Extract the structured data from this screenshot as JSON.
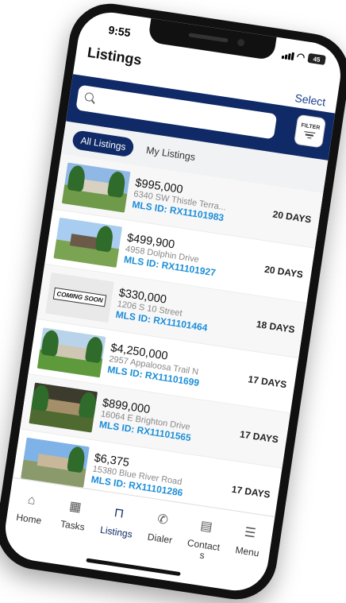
{
  "status": {
    "time": "9:55",
    "battery": "45"
  },
  "header": {
    "title": "Listings",
    "select_label": "Select"
  },
  "search": {
    "placeholder": "",
    "filter_label": "FILTER"
  },
  "tabs": [
    {
      "label": "All Listings",
      "active": true
    },
    {
      "label": "My Listings",
      "active": false
    }
  ],
  "listings": [
    {
      "price": "$995,000",
      "address": "6340 SW Thistle Terra...",
      "mls": "MLS ID: RX11101983",
      "days": "20 DAYS"
    },
    {
      "price": "$499,900",
      "address": "4958 Dolphin Drive",
      "mls": "MLS ID: RX11101927",
      "days": "20 DAYS"
    },
    {
      "price": "$330,000",
      "address": "1206 S 10 Street",
      "mls": "MLS ID: RX11101464",
      "days": "18 DAYS",
      "thumb_text": "COMING SOON"
    },
    {
      "price": "$4,250,000",
      "address": "2957 Appaloosa Trail N",
      "mls": "MLS ID: RX11101699",
      "days": "17 DAYS"
    },
    {
      "price": "$899,000",
      "address": "16064 E Brighton Drive",
      "mls": "MLS ID: RX11101565",
      "days": "17 DAYS"
    },
    {
      "price": "$6,375",
      "address": "15380 Blue River Road",
      "mls": "MLS ID: RX11101286",
      "days": "17 DAYS"
    }
  ],
  "nav": [
    {
      "label": "Home",
      "icon": "home-icon"
    },
    {
      "label": "Tasks",
      "icon": "calendar-icon"
    },
    {
      "label": "Listings",
      "icon": "sign-icon",
      "active": true
    },
    {
      "label": "Dialer",
      "icon": "phone-icon"
    },
    {
      "label": "Contact\ns",
      "icon": "contact-card-icon"
    },
    {
      "label": "Menu",
      "icon": "menu-icon"
    }
  ],
  "colors": {
    "primary": "#0f2a66",
    "accent": "#1c8ed8",
    "link": "#1a3d8f"
  }
}
